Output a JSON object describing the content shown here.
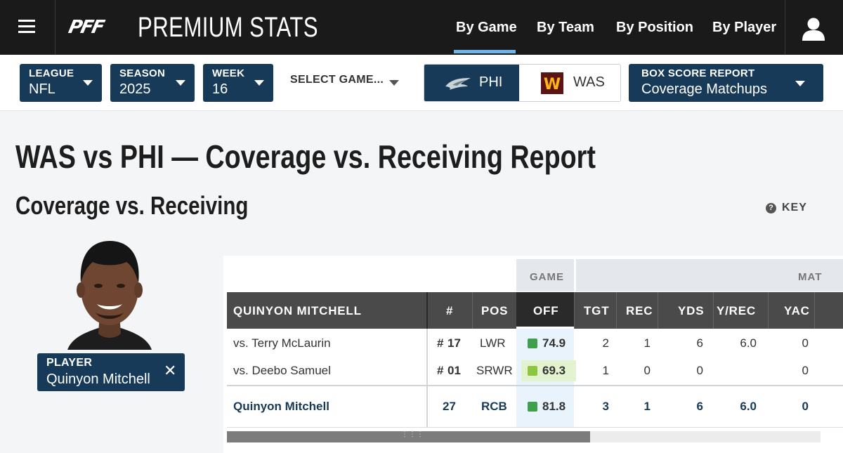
{
  "header": {
    "logo_text": "PFF",
    "app_title": "PREMIUM STATS",
    "nav": [
      "By Game",
      "By Team",
      "By Position",
      "By Player"
    ],
    "active_nav": "By Game",
    "menu_icon": "hamburger-menu-icon",
    "user_icon": "user-account-icon"
  },
  "filters": {
    "league": {
      "label": "LEAGUE",
      "value": "NFL"
    },
    "season": {
      "label": "SEASON",
      "value": "2025"
    },
    "week": {
      "label": "WEEK",
      "value": "16"
    },
    "select_game": "SELECT GAME...",
    "teams": [
      {
        "abbr": "PHI",
        "selected": true
      },
      {
        "abbr": "WAS",
        "selected": false
      }
    ],
    "report": {
      "label": "BOX SCORE REPORT",
      "value": "Coverage Matchups"
    }
  },
  "page": {
    "report_title": "WAS vs PHI — Coverage vs. Receiving Report",
    "section_title": "Coverage vs. Receiving",
    "key_label": "KEY"
  },
  "player": {
    "chip_label": "PLAYER",
    "name": "Quinyon Mitchell",
    "remove_icon": "close-icon"
  },
  "table": {
    "group_headers": {
      "game": "GAME",
      "matchup": "MAT"
    },
    "columns": {
      "player": "QUINYON MITCHELL",
      "num": "#",
      "pos": "POS",
      "off": "OFF",
      "tgt": "TGT",
      "rec": "REC",
      "yds": "YDS",
      "yrec": "Y/REC",
      "yac": "YAC"
    },
    "rows": [
      {
        "name": "vs. Terry McLaurin",
        "num_prefix": "#",
        "num": "17",
        "pos": "LWR",
        "off": "74.9",
        "off_color": "#3ea04d",
        "tgt": "2",
        "rec": "1",
        "yds": "6",
        "yrec": "6.0",
        "yac": "0"
      },
      {
        "name": "vs. Deebo Samuel",
        "num_prefix": "#",
        "num": "01",
        "pos": "SRWR",
        "off": "69.3",
        "off_color": "#8cc63f",
        "tgt": "1",
        "rec": "0",
        "yds": "0",
        "yrec": "",
        "yac": "0"
      }
    ],
    "total": {
      "name": "Quinyon Mitchell",
      "num": "27",
      "pos": "RCB",
      "off": "81.8",
      "off_color": "#3ea04d",
      "tgt": "3",
      "rec": "1",
      "yds": "6",
      "yrec": "6.0",
      "yac": "0"
    }
  },
  "colors": {
    "navy": "#173a59",
    "topbar": "#1a1a1a",
    "nav_underline": "#6fb4e6",
    "grade_green": "#3ea04d",
    "grade_light_green": "#8cc63f"
  }
}
